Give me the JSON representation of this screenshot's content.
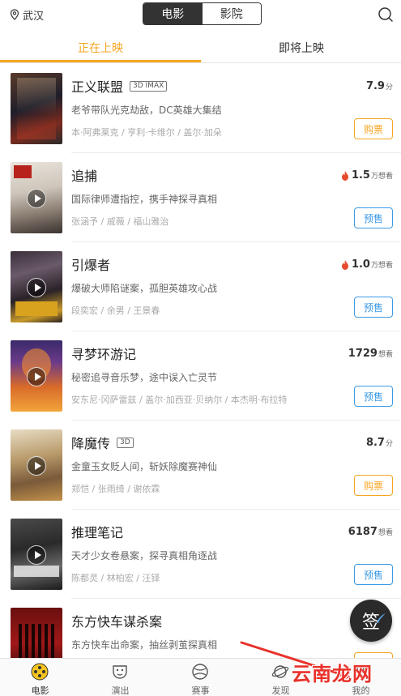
{
  "header": {
    "city": "武汉",
    "seg_movie": "电影",
    "seg_cinema": "影院"
  },
  "tabs": {
    "showing": "正在上映",
    "upcoming": "即将上映"
  },
  "movies": [
    {
      "title": "正义联盟",
      "tag": "3D IMAX",
      "desc": "老爷带队光克劫敌，DC英雄大集结",
      "cast": "本·阿弗莱克 / 亨利·卡维尔 / 盖尔·加朵",
      "score": "7.9",
      "score_unit": "分",
      "button": "购票",
      "button_type": "buy"
    },
    {
      "title": "追捕",
      "tag": "",
      "desc": "国际律师遭指控，携手神探寻真相",
      "cast": "张涵予 / 戚薇 / 福山雅治",
      "score": "1.5",
      "score_unit": "万想看",
      "button": "预售",
      "button_type": "pre",
      "hot": true
    },
    {
      "title": "引爆者",
      "tag": "",
      "desc": "爆破大师陷谜案，孤胆英雄攻心战",
      "cast": "段奕宏 / 余男 / 王景春",
      "score": "1.0",
      "score_unit": "万想看",
      "button": "预售",
      "button_type": "pre",
      "hot": true
    },
    {
      "title": "寻梦环游记",
      "tag": "",
      "desc": "秘密追寻音乐梦，途中误入亡灵节",
      "cast": "安东尼·冈萨雷兹 / 盖尔·加西亚·贝纳尔 / 本杰明·布拉特",
      "score": "1729",
      "score_unit": "想看",
      "button": "预售",
      "button_type": "pre"
    },
    {
      "title": "降魔传",
      "tag": "3D",
      "desc": "金童玉女贬人间，斩妖除魔赛神仙",
      "cast": "郑恺 / 张雨绮 / 谢依霖",
      "score": "8.7",
      "score_unit": "分",
      "button": "购票",
      "button_type": "buy"
    },
    {
      "title": "推理笔记",
      "tag": "",
      "desc": "天才少女卷悬案，探寻真相角逐战",
      "cast": "陈都灵 / 林柏宏 / 汪铎",
      "score": "6187",
      "score_unit": "想看",
      "button": "预售",
      "button_type": "pre"
    },
    {
      "title": "东方快车谋杀案",
      "tag": "",
      "desc": "东方快车出命案，抽丝剥茧探真相",
      "cast": "",
      "score": "",
      "score_unit": "",
      "button": "",
      "button_type": "buy"
    }
  ],
  "floating": {
    "sign_label": "签"
  },
  "bottom_nav": [
    {
      "label": "电影",
      "icon": "film-reel-icon",
      "active": true
    },
    {
      "label": "演出",
      "icon": "mask-icon",
      "active": false
    },
    {
      "label": "赛事",
      "icon": "ball-icon",
      "active": false
    },
    {
      "label": "发现",
      "icon": "planet-icon",
      "active": false
    },
    {
      "label": "我的",
      "icon": "user-icon",
      "active": false
    }
  ],
  "watermark": "云南龙网",
  "colors": {
    "accent": "#f6a623",
    "presale": "#3c9ae6",
    "hot": "#e84a2e"
  }
}
